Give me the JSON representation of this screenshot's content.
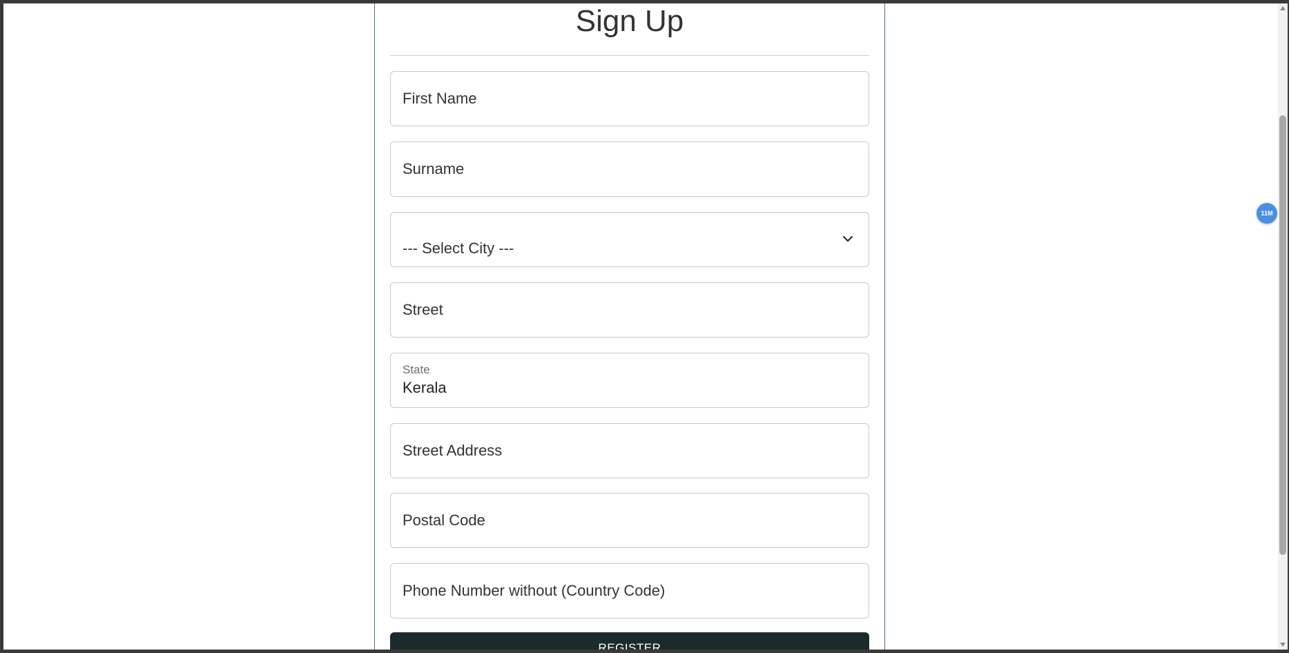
{
  "form": {
    "title": "Sign Up",
    "fields": {
      "first_name": {
        "placeholder": "First Name"
      },
      "surname": {
        "placeholder": "Surname"
      },
      "city": {
        "placeholder": "--- Select City ---"
      },
      "street": {
        "placeholder": "Street"
      },
      "state": {
        "label": "State",
        "value": "Kerala"
      },
      "street_address": {
        "placeholder": "Street Address"
      },
      "postal_code": {
        "placeholder": "Postal Code"
      },
      "phone": {
        "placeholder": "Phone Number without (Country Code)"
      }
    },
    "register_label": "REGISTER"
  },
  "extension_badge": {
    "text": "11M",
    "color": "#4a90e2"
  },
  "colors": {
    "button_bg": "#1b2b2d",
    "card_border": "#4f7474"
  },
  "icons": {
    "select_arrow": "chevron-down-icon"
  }
}
